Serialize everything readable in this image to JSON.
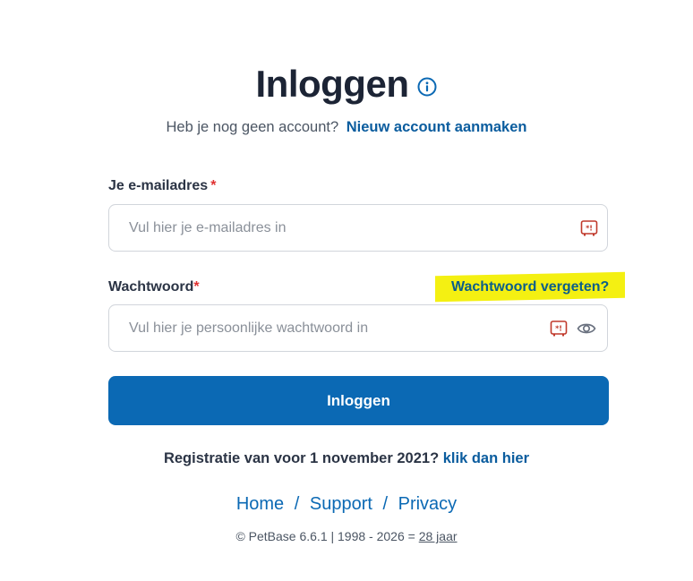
{
  "header": {
    "title": "Inloggen",
    "info_icon": "info-circle-icon"
  },
  "subtitle": {
    "text": "Heb je nog geen account?",
    "link": "Nieuw account aanmaken"
  },
  "email": {
    "label": "Je e-mailadres",
    "required_mark": "*",
    "placeholder": "Vul hier je e-mailadres in",
    "value": "",
    "icon": "password-manager-icon"
  },
  "password": {
    "label": "Wachtwoord",
    "required_mark": "*",
    "placeholder": "Vul hier je persoonlijke wachtwoord in",
    "value": "",
    "forgot_link": "Wachtwoord vergeten?",
    "forgot_highlight_color": "#f4f012",
    "icons": [
      "password-manager-icon",
      "eye-icon"
    ]
  },
  "submit": {
    "label": "Inloggen",
    "color": "#0b69b4"
  },
  "legacy": {
    "text": "Registratie van voor 1 november 2021?",
    "link": "klik dan hier"
  },
  "footer": {
    "links": [
      "Home",
      "Support",
      "Privacy"
    ],
    "separator": "/",
    "copyright_text": "© PetBase 6.6.1 | 1998 - 2026 =",
    "years_link": "28 jaar"
  }
}
